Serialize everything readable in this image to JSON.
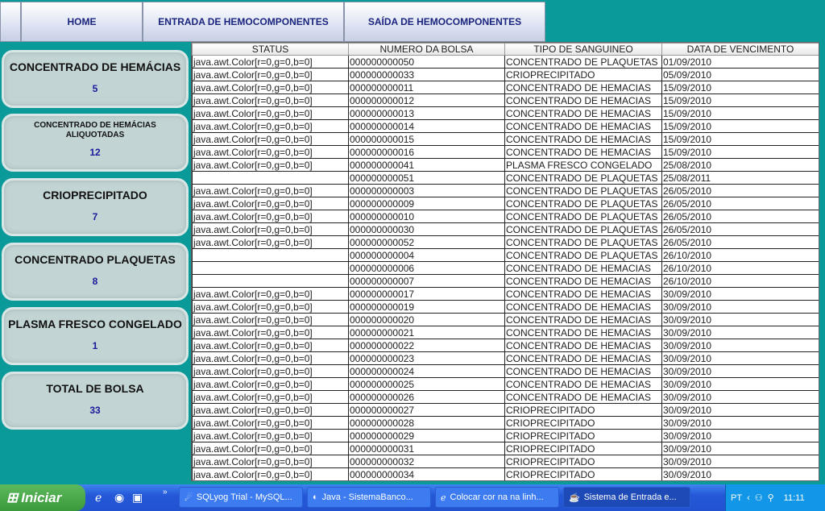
{
  "nav": {
    "home": "HOME",
    "entrada": "ENTRADA DE HEMOCOMPONENTES",
    "saida": "SAÍDA DE HEMOCOMPONENTES"
  },
  "summary": [
    {
      "label": "CONCENTRADO DE HEMÁCIAS",
      "value": "5"
    },
    {
      "label": "CONCENTRADO DE HEMÁCIAS ALIQUOTADAS",
      "value": "12"
    },
    {
      "label": "CRIOPRECIPITADO",
      "value": "7"
    },
    {
      "label": "CONCENTRADO PLAQUETAS",
      "value": "8"
    },
    {
      "label": "PLASMA FRESCO CONGELADO",
      "value": "1"
    },
    {
      "label": "TOTAL DE BOLSA",
      "value": "33"
    }
  ],
  "table": {
    "headers": [
      "STATUS",
      "NUMERO DA BOLSA",
      "TIPO DE SANGUINEO",
      "DATA DE VENCIMENTO"
    ],
    "rows": [
      [
        "java.awt.Color[r=0,g=0,b=0]",
        "000000000050",
        "CONCENTRADO DE PLAQUETAS",
        "01/09/2010"
      ],
      [
        "java.awt.Color[r=0,g=0,b=0]",
        "000000000033",
        "CRIOPRECIPITADO",
        "05/09/2010"
      ],
      [
        "java.awt.Color[r=0,g=0,b=0]",
        "000000000011",
        "CONCENTRADO DE HEMACIAS",
        "15/09/2010"
      ],
      [
        "java.awt.Color[r=0,g=0,b=0]",
        "000000000012",
        "CONCENTRADO DE HEMACIAS",
        "15/09/2010"
      ],
      [
        "java.awt.Color[r=0,g=0,b=0]",
        "000000000013",
        "CONCENTRADO DE HEMACIAS",
        "15/09/2010"
      ],
      [
        "java.awt.Color[r=0,g=0,b=0]",
        "000000000014",
        "CONCENTRADO DE HEMACIAS",
        "15/09/2010"
      ],
      [
        "java.awt.Color[r=0,g=0,b=0]",
        "000000000015",
        "CONCENTRADO DE HEMACIAS",
        "15/09/2010"
      ],
      [
        "java.awt.Color[r=0,g=0,b=0]",
        "000000000016",
        "CONCENTRADO DE HEMACIAS",
        "15/09/2010"
      ],
      [
        "java.awt.Color[r=0,g=0,b=0]",
        "000000000041",
        "PLASMA FRESCO CONGELADO",
        "25/08/2010"
      ],
      [
        "",
        "000000000051",
        "CONCENTRADO DE PLAQUETAS",
        "25/08/2011"
      ],
      [
        "java.awt.Color[r=0,g=0,b=0]",
        "000000000003",
        "CONCENTRADO DE PLAQUETAS",
        "26/05/2010"
      ],
      [
        "java.awt.Color[r=0,g=0,b=0]",
        "000000000009",
        "CONCENTRADO DE PLAQUETAS",
        "26/05/2010"
      ],
      [
        "java.awt.Color[r=0,g=0,b=0]",
        "000000000010",
        "CONCENTRADO DE PLAQUETAS",
        "26/05/2010"
      ],
      [
        "java.awt.Color[r=0,g=0,b=0]",
        "000000000030",
        "CONCENTRADO DE PLAQUETAS",
        "26/05/2010"
      ],
      [
        "java.awt.Color[r=0,g=0,b=0]",
        "000000000052",
        "CONCENTRADO DE PLAQUETAS",
        "26/05/2010"
      ],
      [
        "",
        "000000000004",
        "CONCENTRADO DE PLAQUETAS",
        "26/10/2010"
      ],
      [
        "",
        "000000000006",
        "CONCENTRADO DE HEMACIAS",
        "26/10/2010"
      ],
      [
        "",
        "000000000007",
        "CONCENTRADO DE HEMACIAS",
        "26/10/2010"
      ],
      [
        "java.awt.Color[r=0,g=0,b=0]",
        "000000000017",
        "CONCENTRADO DE HEMACIAS",
        "30/09/2010"
      ],
      [
        "java.awt.Color[r=0,g=0,b=0]",
        "000000000019",
        "CONCENTRADO DE HEMACIAS",
        "30/09/2010"
      ],
      [
        "java.awt.Color[r=0,g=0,b=0]",
        "000000000020",
        "CONCENTRADO DE HEMACIAS",
        "30/09/2010"
      ],
      [
        "java.awt.Color[r=0,g=0,b=0]",
        "000000000021",
        "CONCENTRADO DE HEMACIAS",
        "30/09/2010"
      ],
      [
        "java.awt.Color[r=0,g=0,b=0]",
        "000000000022",
        "CONCENTRADO DE HEMACIAS",
        "30/09/2010"
      ],
      [
        "java.awt.Color[r=0,g=0,b=0]",
        "000000000023",
        "CONCENTRADO DE HEMACIAS",
        "30/09/2010"
      ],
      [
        "java.awt.Color[r=0,g=0,b=0]",
        "000000000024",
        "CONCENTRADO DE HEMACIAS",
        "30/09/2010"
      ],
      [
        "java.awt.Color[r=0,g=0,b=0]",
        "000000000025",
        "CONCENTRADO DE HEMACIAS",
        "30/09/2010"
      ],
      [
        "java.awt.Color[r=0,g=0,b=0]",
        "000000000026",
        "CONCENTRADO DE HEMACIAS",
        "30/09/2010"
      ],
      [
        "java.awt.Color[r=0,g=0,b=0]",
        "000000000027",
        "CRIOPRECIPITADO",
        "30/09/2010"
      ],
      [
        "java.awt.Color[r=0,g=0,b=0]",
        "000000000028",
        "CRIOPRECIPITADO",
        "30/09/2010"
      ],
      [
        "java.awt.Color[r=0,g=0,b=0]",
        "000000000029",
        "CRIOPRECIPITADO",
        "30/09/2010"
      ],
      [
        "java.awt.Color[r=0,g=0,b=0]",
        "000000000031",
        "CRIOPRECIPITADO",
        "30/09/2010"
      ],
      [
        "java.awt.Color[r=0,g=0,b=0]",
        "000000000032",
        "CRIOPRECIPITADO",
        "30/09/2010"
      ],
      [
        "java.awt.Color[r=0,g=0,b=0]",
        "000000000034",
        "CRIOPRECIPITADO",
        "30/09/2010"
      ]
    ]
  },
  "taskbar": {
    "start": "Iniciar",
    "tasks": [
      "SQLyog Trial - MySQL...",
      "Java - SistemaBanco...",
      "Colocar cor na na linh...",
      "Sistema de Entrada e..."
    ],
    "lang": "PT",
    "clock": "11:11"
  }
}
